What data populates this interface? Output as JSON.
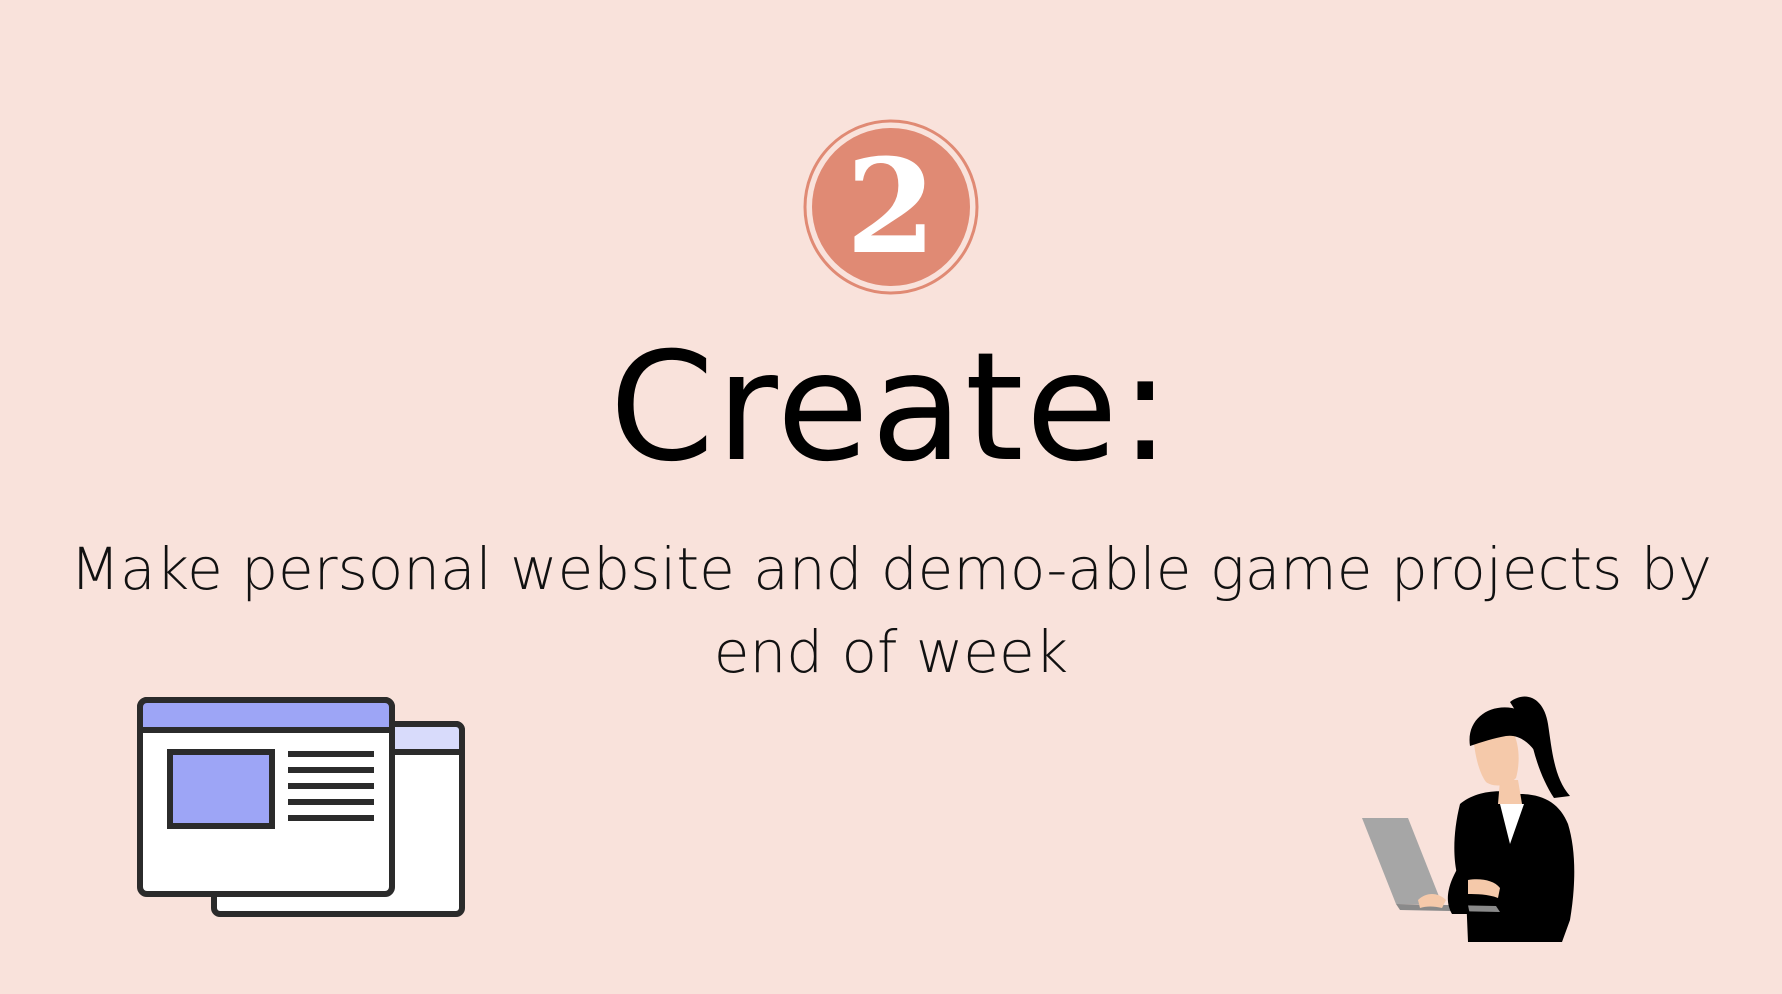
{
  "step": {
    "number": "2",
    "badge_fill": "#e08a74",
    "badge_ring": "#e08a74",
    "number_color": "#ffffff"
  },
  "title": "Create:",
  "subtitle": "Make personal website and demo-able game projects by end of week",
  "colors": {
    "background": "#f9e2db",
    "text": "#000000",
    "window_accent": "#9da5f6",
    "window_accent_light": "#d8dbfb",
    "outline": "#2b2b2b",
    "laptop": "#a6a6a6",
    "skin": "#f5c9aa"
  },
  "illustrations": {
    "left": "browser-windows-icon",
    "right": "woman-with-laptop-illustration"
  }
}
